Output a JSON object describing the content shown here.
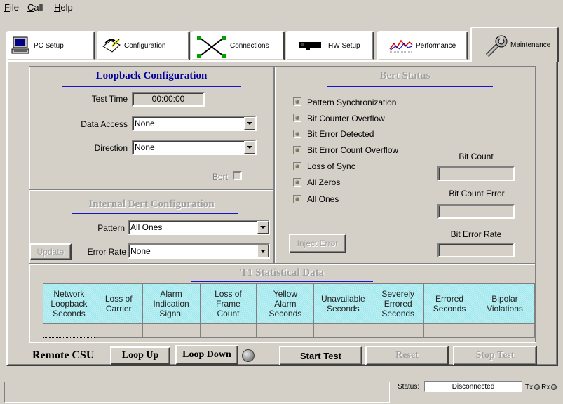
{
  "menu": [
    {
      "label": "File",
      "accel": "F",
      "rest": "ile"
    },
    {
      "label": "Call",
      "accel": "C",
      "rest": "all"
    },
    {
      "label": "Help",
      "accel": "H",
      "rest": "elp"
    }
  ],
  "tabs": [
    {
      "label": "PC Setup",
      "icon": "computer-icon"
    },
    {
      "label": "Configuration",
      "icon": "configuration-icon"
    },
    {
      "label": "Connections",
      "icon": "connections-icon"
    },
    {
      "label": "HW Setup",
      "icon": "hardware-icon"
    },
    {
      "label": "Performance",
      "icon": "performance-icon"
    },
    {
      "label": "Maintenance",
      "icon": "wrench-icon",
      "active": true
    }
  ],
  "loopback": {
    "title": "Loopback Configuration",
    "test_time_label": "Test Time",
    "test_time_value": "00:00:00",
    "data_access_label": "Data Access",
    "data_access_value": "None",
    "direction_label": "Direction",
    "direction_value": "None",
    "bert_label": "Bert"
  },
  "internal_bert": {
    "title": "Internal Bert Configuration",
    "pattern_label": "Pattern",
    "pattern_value": "All Ones",
    "error_rate_label": "Error Rate",
    "error_rate_value": "None",
    "update_label": "Update"
  },
  "bert_status": {
    "title": "Bert Status",
    "items": [
      "Pattern Synchronization",
      "Bit Counter Overflow",
      "Bit Error Detected",
      "Bit Error Count Overflow",
      "Loss of Sync",
      "All Zeros",
      "All Ones"
    ],
    "bit_count_label": "Bit Count",
    "bit_count_error_label": "Bit Count Error",
    "bit_error_rate_label": "Bit Error Rate",
    "inject_error_label": "Inject Error"
  },
  "t1_stats": {
    "title": "T1 Statistical Data",
    "columns": [
      [
        "Network",
        "Loopback",
        "Seconds"
      ],
      [
        "Loss of",
        "Carrier"
      ],
      [
        "Alarm",
        "Indication",
        "Signal"
      ],
      [
        "Loss of",
        "Frame",
        "Count"
      ],
      [
        "Yellow",
        "Alarm",
        "Seconds"
      ],
      [
        "Unavailable",
        "Seconds"
      ],
      [
        "Severely",
        "Errored",
        "Seconds"
      ],
      [
        "Errored",
        "Seconds"
      ],
      [
        "Bipolar",
        "Violations"
      ]
    ],
    "values": [
      "",
      "",
      "",
      "",
      "",
      "",
      "",
      "",
      ""
    ]
  },
  "remote": {
    "label": "Remote CSU",
    "loop_up": "Loop Up",
    "loop_down": "Loop Down",
    "start_test": "Start Test",
    "reset": "Reset",
    "stop_test": "Stop Test"
  },
  "statusbar": {
    "status_label": "Status:",
    "status_value": "Disconnected",
    "tx_label": "Tx",
    "rx_label": "Rx"
  },
  "colors": {
    "face": "#d4d0c8",
    "title_blue": "#00009c",
    "table_header": "#9ee8ee"
  }
}
